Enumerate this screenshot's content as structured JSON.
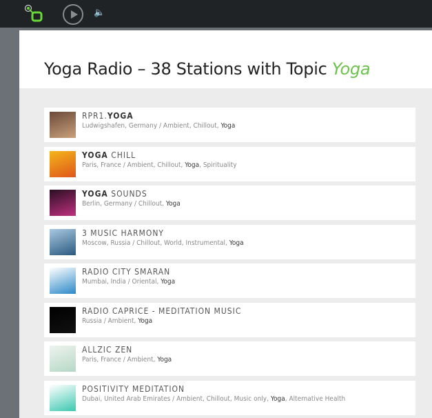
{
  "header": {
    "title_prefix": "Yoga Radio – 38 Stations with Topic ",
    "title_topic": "Yoga"
  },
  "player": {
    "logo": "radio-logo",
    "play": "play-icon",
    "volume": "volume-icon"
  },
  "accent": "#6cc24a",
  "stations": [
    {
      "name_pre": "RPR1.",
      "name_bold": "YOGA",
      "name_post": "",
      "meta": "Ludwigshafen, Germany / Ambient, Chillout, ",
      "hl": "Yoga",
      "meta_post": "",
      "thumb": [
        "#6b4a3a",
        "#c9a07a"
      ]
    },
    {
      "name_pre": "",
      "name_bold": "YOGA",
      "name_post": " CHILL",
      "meta": "Paris, France / Ambient, Chillout, ",
      "hl": "Yoga",
      "meta_post": ", Spirituality",
      "thumb": [
        "#f3b51a",
        "#e0561a"
      ]
    },
    {
      "name_pre": "",
      "name_bold": "YOGA",
      "name_post": " SOUNDS",
      "meta": "Berlin, Germany / Chillout, ",
      "hl": "Yoga",
      "meta_post": "",
      "thumb": [
        "#2a0f22",
        "#c03080"
      ]
    },
    {
      "name_pre": "3 MUSIC HARMONY",
      "name_bold": "",
      "name_post": "",
      "meta": "Moscow, Russia / Chillout, World, Instrumental, ",
      "hl": "Yoga",
      "meta_post": "",
      "thumb": [
        "#a9c8e0",
        "#2a5a80"
      ]
    },
    {
      "name_pre": "RADIO CITY SMARAN",
      "name_bold": "",
      "name_post": "",
      "meta": "Mumbai, India / Oriental, ",
      "hl": "Yoga",
      "meta_post": "",
      "thumb": [
        "#ffffff",
        "#2a88c8"
      ]
    },
    {
      "name_pre": "RADIO CAPRICE - MEDITATION MUSIC",
      "name_bold": "",
      "name_post": "",
      "meta": "Russia / Ambient, ",
      "hl": "Yoga",
      "meta_post": "",
      "thumb": [
        "#000000",
        "#111111"
      ]
    },
    {
      "name_pre": "ALLZIC ZEN",
      "name_bold": "",
      "name_post": "",
      "meta": "Paris, France / Ambient, ",
      "hl": "Yoga",
      "meta_post": "",
      "thumb": [
        "#eef3ef",
        "#b5d8c5"
      ]
    },
    {
      "name_pre": "POSITIVITY MEDITATION",
      "name_bold": "",
      "name_post": "",
      "meta": "Dubai, United Arab Emirates / Ambient, Chillout, Music only, ",
      "hl": "Yoga",
      "meta_post": ", Alternative Health",
      "thumb": [
        "#ffffff",
        "#3cc8b0"
      ]
    }
  ]
}
